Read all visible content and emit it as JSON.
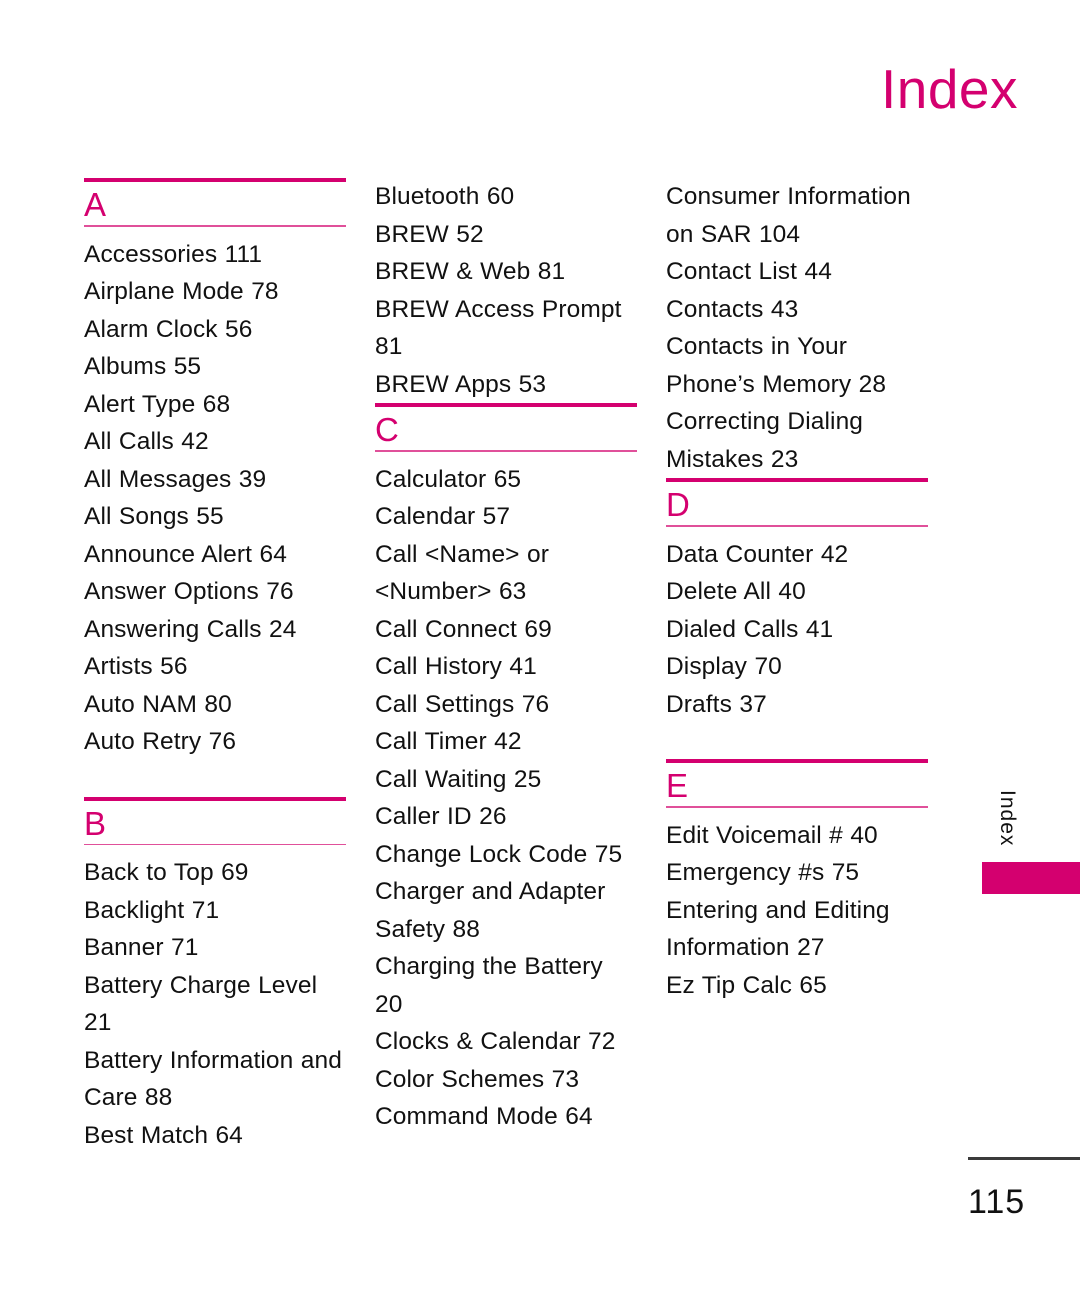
{
  "page": {
    "heading": "Index",
    "number": "115",
    "tab_label": "Index",
    "accent_color": "#d4006f",
    "rule_color_thin": "#e0509a",
    "text_color": "#111111"
  },
  "columns": [
    {
      "blocks": [
        {
          "type": "section",
          "letter": "A",
          "entries": [
            "Accessories 111",
            "Airplane Mode 78",
            "Alarm Clock 56",
            "Albums 55",
            "Alert Type 68",
            "All Calls 42",
            "All Messages 39",
            "All Songs 55",
            "Announce Alert 64",
            "Answer Options 76",
            "Answering Calls 24",
            "Artists 56",
            "Auto NAM 80",
            "Auto Retry 76"
          ]
        },
        {
          "type": "section",
          "letter": "B",
          "entries": [
            "Back to Top 69",
            "Backlight 71",
            "Banner 71",
            "Battery Charge Level 21",
            "Battery Information and Care 88",
            "Best Match 64"
          ]
        }
      ]
    },
    {
      "blocks": [
        {
          "type": "continuation",
          "entries": [
            "Bluetooth 60",
            "BREW 52",
            "BREW & Web 81",
            "BREW Access Prompt 81",
            "BREW Apps 53"
          ]
        },
        {
          "type": "section",
          "letter": "C",
          "entries": [
            "Calculator 65",
            "Calendar 57",
            "Call <Name> or <Number> 63",
            "Call Connect 69",
            "Call History 41",
            "Call Settings 76",
            "Call Timer 42",
            "Call Waiting 25",
            "Caller ID 26",
            "Change Lock Code 75",
            "Charger and Adapter Safety 88",
            "Charging the Battery 20",
            "Clocks & Calendar 72",
            "Color Schemes 73",
            "Command Mode 64"
          ]
        }
      ]
    },
    {
      "blocks": [
        {
          "type": "continuation",
          "entries": [
            "Consumer Information on SAR 104",
            "Contact List 44",
            "Contacts 43",
            "Contacts in Your Phone’s Memory 28",
            "Correcting Dialing Mistakes 23"
          ]
        },
        {
          "type": "section",
          "letter": "D",
          "entries": [
            "Data Counter 42",
            "Delete All 40",
            "Dialed Calls 41",
            "Display 70",
            "Drafts 37"
          ]
        },
        {
          "type": "section",
          "letter": "E",
          "entries": [
            "Edit Voicemail # 40",
            "Emergency #s 75",
            "Entering and Editing Information 27",
            "Ez Tip Calc 65"
          ]
        }
      ]
    }
  ]
}
